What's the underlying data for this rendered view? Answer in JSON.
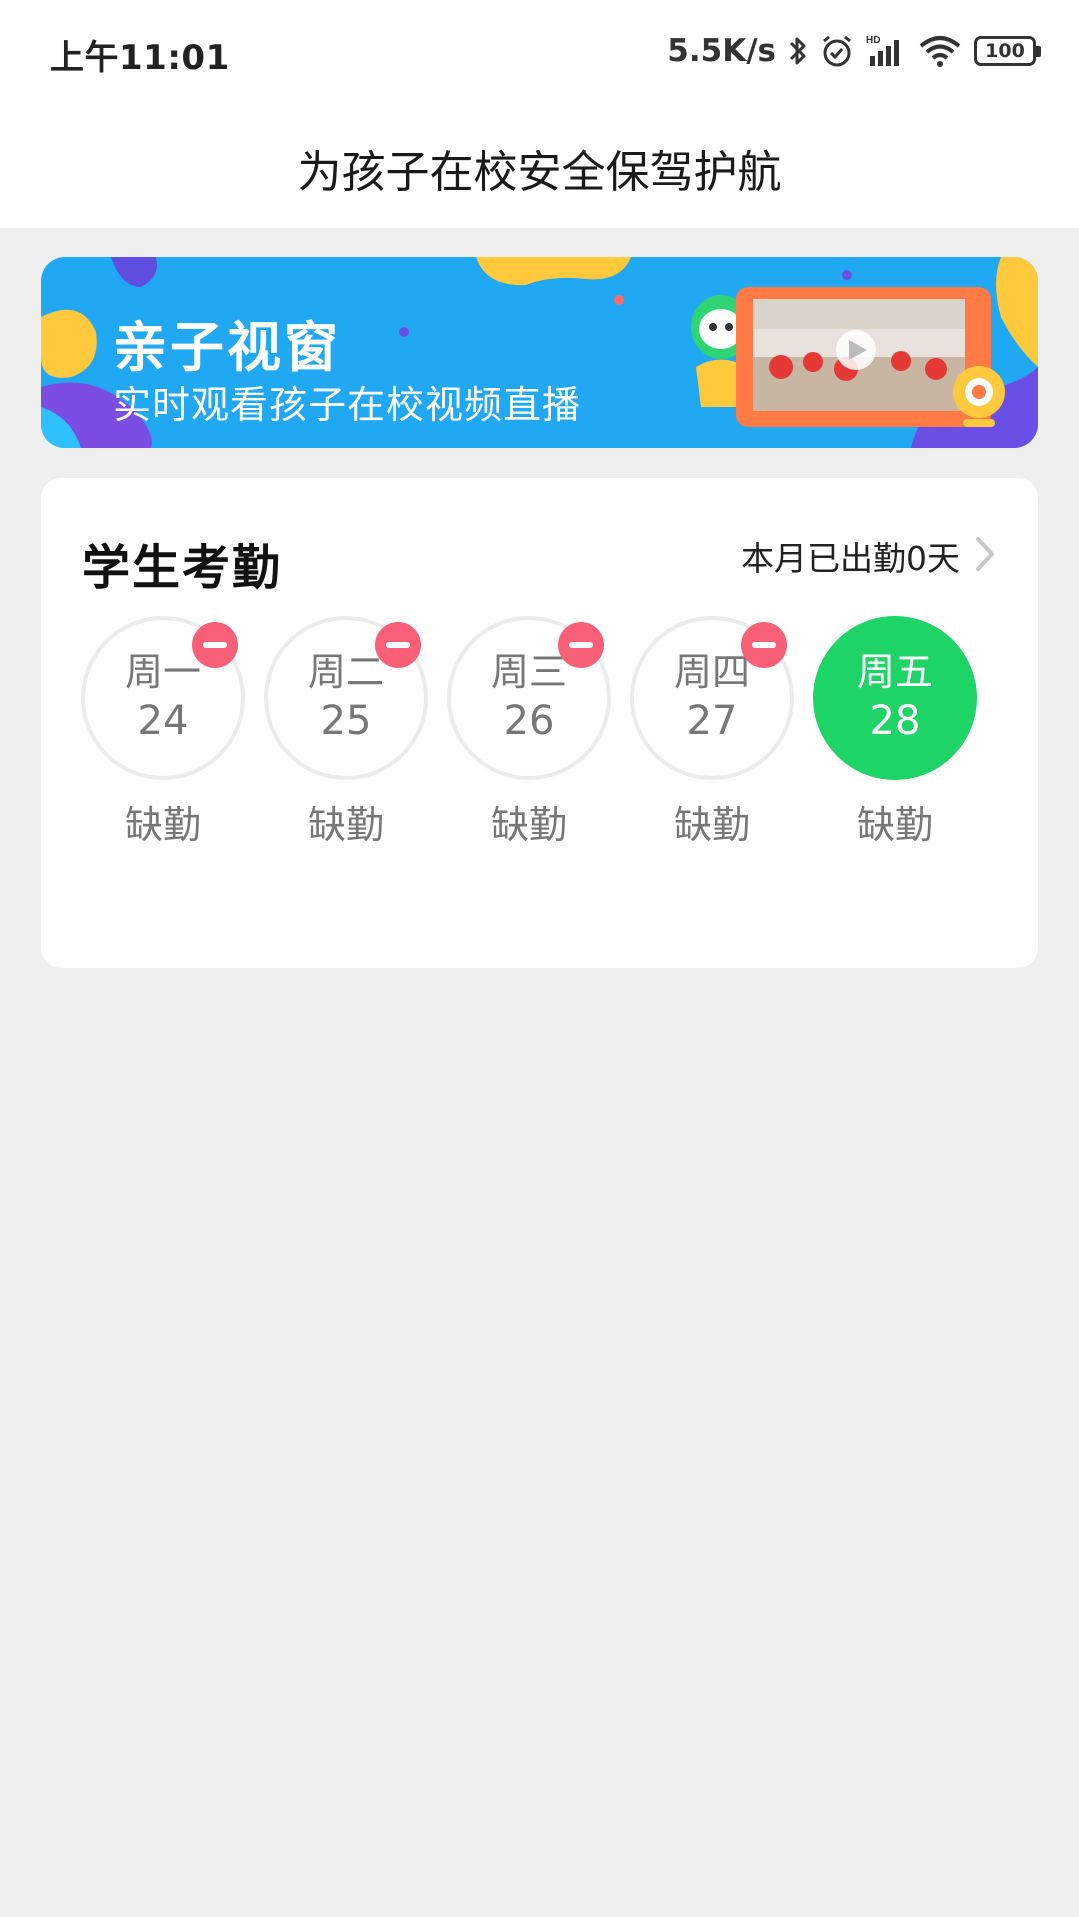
{
  "status_bar": {
    "time": "上午11:01",
    "net_speed": "5.5K/s",
    "battery": "100",
    "icons": [
      "bluetooth-icon",
      "alarm-icon",
      "hd-signal-icon",
      "wifi-icon",
      "battery-icon"
    ]
  },
  "header": {
    "title": "为孩子在校安全保驾护航"
  },
  "banner": {
    "title": "亲子视窗",
    "subtitle": "实时观看孩子在校视频直播",
    "bg_color": "#21a8f3"
  },
  "attendance": {
    "title": "学生考勤",
    "summary": "本月已出勤0天",
    "days": [
      {
        "weekday": "周一",
        "date": "24",
        "status": "缺勤",
        "absent_badge": true,
        "active": false
      },
      {
        "weekday": "周二",
        "date": "25",
        "status": "缺勤",
        "absent_badge": true,
        "active": false
      },
      {
        "weekday": "周三",
        "date": "26",
        "status": "缺勤",
        "absent_badge": true,
        "active": false
      },
      {
        "weekday": "周四",
        "date": "27",
        "status": "缺勤",
        "absent_badge": true,
        "active": false
      },
      {
        "weekday": "周五",
        "date": "28",
        "status": "缺勤",
        "absent_badge": false,
        "active": true
      }
    ],
    "colors": {
      "active": "#1ed466",
      "absent_badge": "#fa5f78"
    }
  }
}
